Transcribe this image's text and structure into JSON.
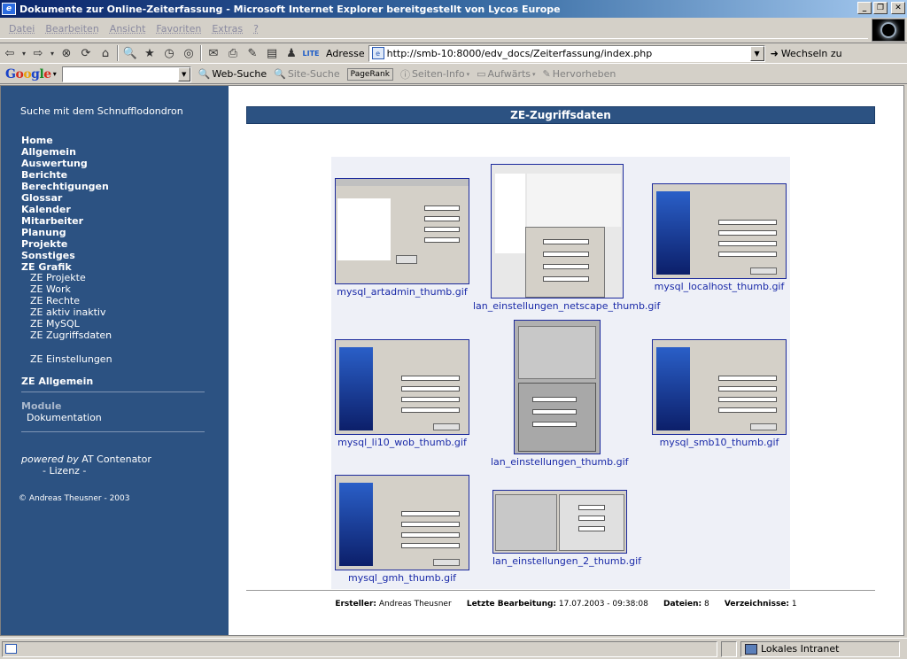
{
  "window": {
    "title": "Dokumente zur Online-Zeiterfassung - Microsoft Internet Explorer bereitgestellt von Lycos Europe",
    "controls": {
      "minimize": "_",
      "maximize": "❐",
      "close": "✕"
    }
  },
  "menubar": [
    "Datei",
    "Bearbeiten",
    "Ansicht",
    "Favoriten",
    "Extras",
    "?"
  ],
  "toolbar": {
    "address_label": "Adresse",
    "url": "http://smb-10:8000/edv_docs/Zeiterfassung/index.php",
    "go_label": "Wechseln zu"
  },
  "googlebar": {
    "logo": [
      "G",
      "o",
      "o",
      "g",
      "l",
      "e"
    ],
    "web_search": "Web-Suche",
    "site_search": "Site-Suche",
    "pagerank": "PageRank",
    "page_info": "Seiten-Info",
    "up": "Aufwärts",
    "highlight": "Hervorheben"
  },
  "sidebar": {
    "search_link": "Suche mit dem Schnufflodondron",
    "main_items": [
      "Home",
      "Allgemein",
      "Auswertung",
      "Berichte",
      "Berechtigungen",
      "Glossar",
      "Kalender",
      "Mitarbeiter",
      "Planung",
      "Projekte",
      "Sonstiges",
      "ZE Grafik"
    ],
    "sub_items": [
      "ZE Projekte",
      "ZE Work",
      "ZE Rechte",
      "ZE aktiv inaktiv",
      "ZE MySQL",
      "ZE Zugriffsdaten"
    ],
    "settings_item": "ZE Einstellungen",
    "ze_allgemein": "ZE Allgemein",
    "module_label": "Module",
    "module_item": "Dokumentation",
    "powered_prefix": "powered by",
    "powered_name": "AT Contenator",
    "license": "- Lizenz -",
    "copyright": "© Andreas Theusner - 2003"
  },
  "main": {
    "heading": "ZE-Zugriffsdaten",
    "thumbs": [
      {
        "caption": "mysql_artadmin_thumb.gif",
        "style": "admin"
      },
      {
        "caption": "lan_einstellungen_netscape_thumb.gif",
        "style": "netscape"
      },
      {
        "caption": "mysql_localhost_thumb.gif",
        "style": "mysql"
      },
      {
        "caption": "mysql_li10_wob_thumb.gif",
        "style": "mysql"
      },
      {
        "caption": "lan_einstellungen_thumb.gif",
        "style": "lan"
      },
      {
        "caption": "mysql_smb10_thumb.gif",
        "style": "mysql"
      },
      {
        "caption": "mysql_gmh_thumb.gif",
        "style": "mysql"
      },
      {
        "caption": "lan_einstellungen_2_thumb.gif",
        "style": "lan2"
      }
    ],
    "footer": {
      "creator_label": "Ersteller:",
      "creator": "Andreas Theusner",
      "edited_label": "Letzte Bearbeitung:",
      "edited": "17.07.2003 - 09:38:08",
      "files_label": "Dateien:",
      "files": "8",
      "dirs_label": "Verzeichnisse:",
      "dirs": "1"
    }
  },
  "statusbar": {
    "zone": "Lokales Intranet"
  }
}
